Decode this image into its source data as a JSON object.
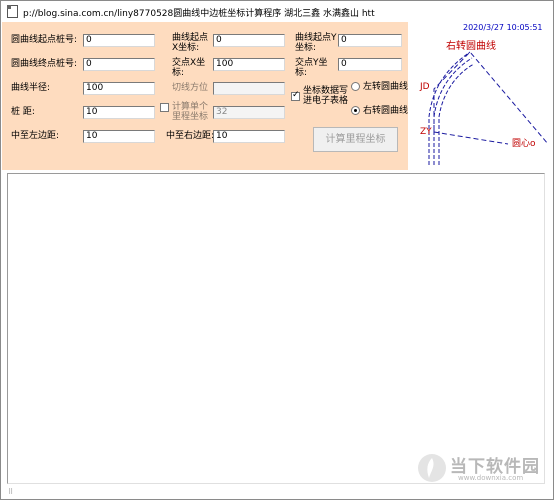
{
  "window": {
    "title": "p://blog.sina.com.cn/liny8770528圆曲线中边桩坐标计算程序    湖北三鑫   水满鑫山   htt"
  },
  "form": {
    "start_station_label": "圆曲线起点桩号:",
    "start_station_value": "0",
    "curve_start_x_label": "曲线起点X坐标:",
    "curve_start_x_value": "0",
    "curve_start_y_label": "曲线起点Y坐标:",
    "curve_start_y_value": "0",
    "end_station_label": "圆曲线终点桩号:",
    "end_station_value": "0",
    "intersection_x_label": "交点X坐标:",
    "intersection_x_value": "100",
    "intersection_y_label": "交点Y坐标:",
    "intersection_y_value": "0",
    "radius_label": "曲线半径:",
    "radius_value": "100",
    "tangent_bearing_label": "切线方位",
    "tangent_bearing_value": "",
    "pile_distance_label": "桩  距:",
    "pile_distance_value": "10",
    "single_calc_label": "计算单个里程坐标",
    "single_calc_value": "32",
    "left_edge_label": "中至左边距:",
    "left_edge_value": "10",
    "right_edge_label": "中至右边距:",
    "right_edge_value": "10",
    "write_excel_label": "坐标数据写进电子表格",
    "left_curve_label": "左转圆曲线",
    "right_curve_label": "右转圆曲线",
    "calculate_button": "计算里程坐标"
  },
  "diagram": {
    "timestamp": "2020/3/27 10:05:51",
    "right_curve_caption": "右转圆曲线",
    "jd_label": "JD",
    "zy_label": "ZY",
    "center_label": "圆心o"
  },
  "watermark": {
    "text": "当下软件园",
    "url": "www.downxia.com"
  },
  "colors": {
    "panel_background": "#fedcbf",
    "timestamp": "#0000c0",
    "diagram_red": "#c00000",
    "diagram_blue": "#1a1aa0"
  }
}
